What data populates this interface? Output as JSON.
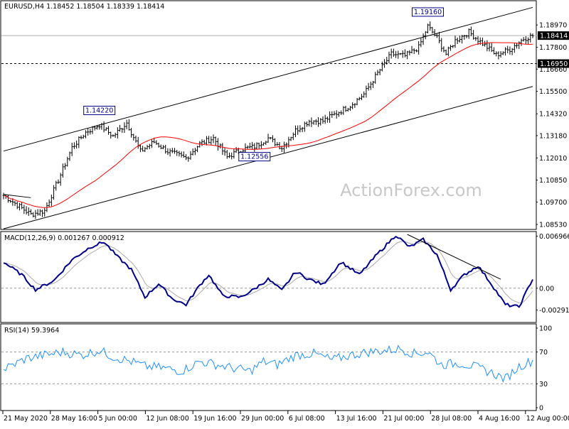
{
  "chart_data": [
    {
      "type": "candlestick",
      "title": "EURUSD,H4  1.18452 1.18504 1.18339 1.18414",
      "yticks": [
        1.1897,
        1.178,
        1.1666,
        1.155,
        1.1432,
        1.1318,
        1.1201,
        1.1085,
        1.097,
        1.0853
      ],
      "ytick_labels": [
        "1.18970",
        "1.17800",
        "1.16660",
        "1.15500",
        "1.14320",
        "1.13180",
        "1.12010",
        "1.10850",
        "1.09700",
        "1.08530"
      ],
      "ylim": [
        1.0838,
        1.1998
      ],
      "price_badges": [
        {
          "value": 1.18414,
          "label": "1.18414",
          "color": "#000000"
        },
        {
          "value": 1.1695,
          "label": "1.16950",
          "color": "#000000"
        }
      ],
      "peak_labels": [
        {
          "label": "1.14220",
          "bar": 42
        },
        {
          "label": "1.12556",
          "bar": 110
        },
        {
          "label": "1.19160",
          "bar": 186
        }
      ],
      "watermark": "ActionForex.com",
      "ma_color": "#ff0000",
      "channel_color": "#000000",
      "close_path": [
        [
          0,
          1.1005
        ],
        [
          12,
          1.0905
        ],
        [
          18,
          1.0925
        ],
        [
          24,
          1.1085
        ],
        [
          30,
          1.1255
        ],
        [
          36,
          1.1335
        ],
        [
          42,
          1.1375
        ],
        [
          48,
          1.1315
        ],
        [
          54,
          1.1385
        ],
        [
          60,
          1.1235
        ],
        [
          66,
          1.1285
        ],
        [
          72,
          1.1235
        ],
        [
          80,
          1.12
        ],
        [
          86,
          1.1275
        ],
        [
          92,
          1.1305
        ],
        [
          98,
          1.1205
        ],
        [
          104,
          1.1245
        ],
        [
          110,
          1.126
        ],
        [
          116,
          1.1305
        ],
        [
          122,
          1.1255
        ],
        [
          128,
          1.1345
        ],
        [
          134,
          1.1395
        ],
        [
          140,
          1.1395
        ],
        [
          146,
          1.1435
        ],
        [
          152,
          1.1475
        ],
        [
          158,
          1.1535
        ],
        [
          164,
          1.1645
        ],
        [
          170,
          1.1745
        ],
        [
          176,
          1.1735
        ],
        [
          182,
          1.178
        ],
        [
          186,
          1.189
        ],
        [
          190,
          1.183
        ],
        [
          194,
          1.1745
        ],
        [
          198,
          1.1815
        ],
        [
          204,
          1.186
        ],
        [
          210,
          1.18
        ],
        [
          216,
          1.174
        ],
        [
          222,
          1.177
        ],
        [
          228,
          1.1825
        ],
        [
          232,
          1.1841
        ]
      ]
    },
    {
      "type": "line",
      "title": "MACD(12,26,9) 0.001267 0.000912",
      "yticks": [
        0.006966,
        0.0,
        -0.002913
      ],
      "ytick_labels": [
        "0.006966",
        "0.00",
        "-0.002913"
      ],
      "ylim": [
        -0.0042,
        0.0072
      ],
      "series_colors": {
        "macd": "#00008b",
        "signal": "#a9a9a9"
      },
      "macd_path": [
        [
          0,
          0.0035
        ],
        [
          8,
          0.0018
        ],
        [
          14,
          -0.0002
        ],
        [
          22,
          0.001
        ],
        [
          30,
          0.0038
        ],
        [
          38,
          0.0055
        ],
        [
          44,
          0.0062
        ],
        [
          50,
          0.0042
        ],
        [
          56,
          0.0025
        ],
        [
          62,
          -0.0012
        ],
        [
          68,
          0.0006
        ],
        [
          74,
          -0.0014
        ],
        [
          80,
          -0.0022
        ],
        [
          86,
          0.0004
        ],
        [
          90,
          0.0018
        ],
        [
          96,
          -0.001
        ],
        [
          104,
          -0.0012
        ],
        [
          110,
          -0.0001
        ],
        [
          116,
          0.0012
        ],
        [
          122,
          -0.0003
        ],
        [
          128,
          0.0022
        ],
        [
          134,
          0.0012
        ],
        [
          140,
          0.0005
        ],
        [
          148,
          0.0035
        ],
        [
          156,
          0.0018
        ],
        [
          164,
          0.0046
        ],
        [
          172,
          0.0071
        ],
        [
          178,
          0.0055
        ],
        [
          184,
          0.0065
        ],
        [
          190,
          0.0045
        ],
        [
          196,
          -0.0002
        ],
        [
          202,
          0.0018
        ],
        [
          208,
          0.003
        ],
        [
          214,
          0.0005
        ],
        [
          220,
          -0.0022
        ],
        [
          226,
          -0.0025
        ],
        [
          232,
          0.00127
        ]
      ]
    },
    {
      "type": "line",
      "title": "RSI(14) 59.3964",
      "yticks": [
        100,
        70,
        30,
        0
      ],
      "ytick_labels": [
        "100",
        "70",
        "30",
        "0"
      ],
      "ylim": [
        0,
        100
      ],
      "series_color": "#1e90ff",
      "rsi_path": [
        [
          0,
          48
        ],
        [
          10,
          62
        ],
        [
          18,
          66
        ],
        [
          26,
          70
        ],
        [
          34,
          66
        ],
        [
          42,
          72
        ],
        [
          48,
          64
        ],
        [
          56,
          58
        ],
        [
          62,
          52
        ],
        [
          70,
          50
        ],
        [
          78,
          46
        ],
        [
          86,
          58
        ],
        [
          92,
          55
        ],
        [
          100,
          50
        ],
        [
          108,
          46
        ],
        [
          114,
          58
        ],
        [
          120,
          54
        ],
        [
          128,
          66
        ],
        [
          136,
          68
        ],
        [
          144,
          60
        ],
        [
          152,
          66
        ],
        [
          160,
          70
        ],
        [
          168,
          72
        ],
        [
          174,
          74
        ],
        [
          180,
          68
        ],
        [
          186,
          70
        ],
        [
          192,
          54
        ],
        [
          200,
          56
        ],
        [
          206,
          52
        ],
        [
          214,
          44
        ],
        [
          220,
          36
        ],
        [
          226,
          52
        ],
        [
          232,
          59
        ]
      ]
    }
  ],
  "x_axis": {
    "labels": [
      "21 May 2020",
      "28 May 16:00",
      "5 Jun 00:00",
      "12 Jun 08:00",
      "19 Jun 16:00",
      "29 Jun 00:00",
      "6 Jul 08:00",
      "13 Jul 16:00",
      "21 Jul 00:00",
      "28 Jul 08:00",
      "4 Aug 16:00",
      "12 Aug 00:00"
    ],
    "bar_count": 233
  }
}
